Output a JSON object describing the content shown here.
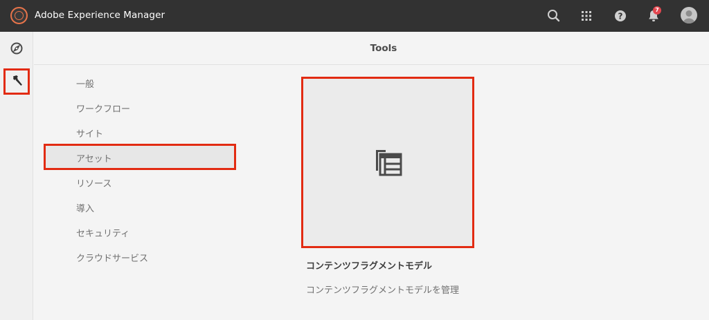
{
  "topbar": {
    "app_title": "Adobe Experience Manager",
    "notification_count": "7",
    "icons": [
      "search-icon",
      "apps-grid-icon",
      "help-icon",
      "bell-icon",
      "avatar"
    ]
  },
  "rail": {
    "items": [
      {
        "name": "navigation-compass-icon"
      },
      {
        "name": "tools-hammer-icon",
        "selected": true
      }
    ]
  },
  "header": {
    "title": "Tools"
  },
  "nav": {
    "items": [
      {
        "label": "一般"
      },
      {
        "label": "ワークフロー"
      },
      {
        "label": "サイト"
      },
      {
        "label": "アセット",
        "selected": true
      },
      {
        "label": "リソース"
      },
      {
        "label": "導入"
      },
      {
        "label": "セキュリティ"
      },
      {
        "label": "クラウドサービス"
      }
    ]
  },
  "card": {
    "title": "コンテンツフラグメントモデル",
    "description": "コンテンツフラグメントモデルを管理",
    "icon": "content-fragment-model-icon"
  },
  "colors": {
    "topbar": "#323232",
    "highlight": "#e22b12",
    "notification_badge": "#e34850",
    "logo_accent": "#e8744a"
  }
}
